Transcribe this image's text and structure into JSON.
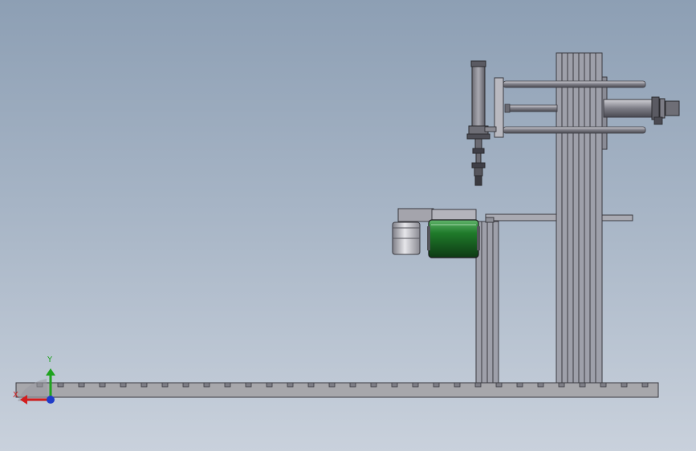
{
  "viewport": {
    "view": "side elevation",
    "background_top": "#8d9fb4",
    "background_bottom": "#c9d1dc"
  },
  "triad": {
    "x_label": "X",
    "y_label": "Y",
    "x_color": "#d21e1e",
    "y_color": "#1fa31f",
    "z_color": "#1f3cc8"
  },
  "colors": {
    "steel": "#9a9aa4",
    "steel_dark": "#5e5e66",
    "edge": "#3a3a40",
    "green_roller": "#1f7a2a",
    "cylinder": "#c8c8cc"
  },
  "icons": [
    "coordinate-triad-icon"
  ]
}
